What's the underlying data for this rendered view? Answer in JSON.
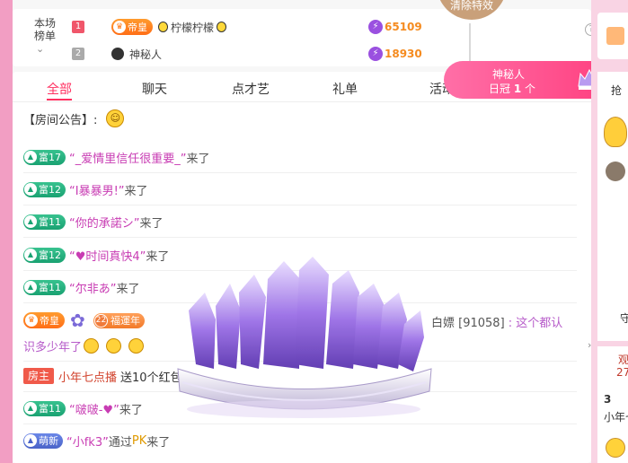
{
  "rank": {
    "title": "本场\n榜单",
    "rows": [
      {
        "num": "1",
        "badge": "帝皇",
        "name": "柠檬柠檬",
        "score": "65109"
      },
      {
        "num": "2",
        "name": "神秘人",
        "score": "18930"
      }
    ],
    "help": "?"
  },
  "balloon": {
    "label": "清除特效"
  },
  "float": {
    "name": "神秘人",
    "rank_prefix": "日冠",
    "rank_value": "1",
    "rank_suffix": "个"
  },
  "tabs": [
    {
      "label": "全部",
      "active": true
    },
    {
      "label": "聊天"
    },
    {
      "label": "点才艺"
    },
    {
      "label": "礼单"
    },
    {
      "label": "活动"
    }
  ],
  "notice": {
    "label": "【房间公告】:"
  },
  "messages": [
    {
      "level": "富17",
      "user": "“_爱情里信任很重要_”",
      "action": "来了"
    },
    {
      "level": "富12",
      "user": "“I暴暴男!”",
      "action": "来了"
    },
    {
      "level": "富11",
      "user": "“你的承諾シ”",
      "action": "来了"
    },
    {
      "level": "富12",
      "user": "“♥时间真快4”",
      "action": "来了"
    },
    {
      "level": "富11",
      "user": "“尔非あ”",
      "action": "来了"
    }
  ],
  "long_msg": {
    "badge": "帝皇",
    "badge2_num": "22",
    "badge2_label": "福運年",
    "tail_name": "白嫖",
    "tail_id": "[91058]",
    "tail_text": ": 这个都认",
    "line2": "识多少年了"
  },
  "host_msg": {
    "tag": "房主",
    "name": "小年七点播",
    "text": "送10个红包"
  },
  "msg_bobo": {
    "level": "富11",
    "user": "“啵啵-♥”",
    "action": "来了"
  },
  "msg_pk": {
    "level": "萌新",
    "user": "“小fk3”",
    "via": "通过",
    "pk": "PK",
    "action": "来了"
  },
  "right": {
    "item1": "抢",
    "item2": "守",
    "item3_top": "观",
    "item3_num": "27",
    "item4": "3",
    "item5": "小年七"
  }
}
